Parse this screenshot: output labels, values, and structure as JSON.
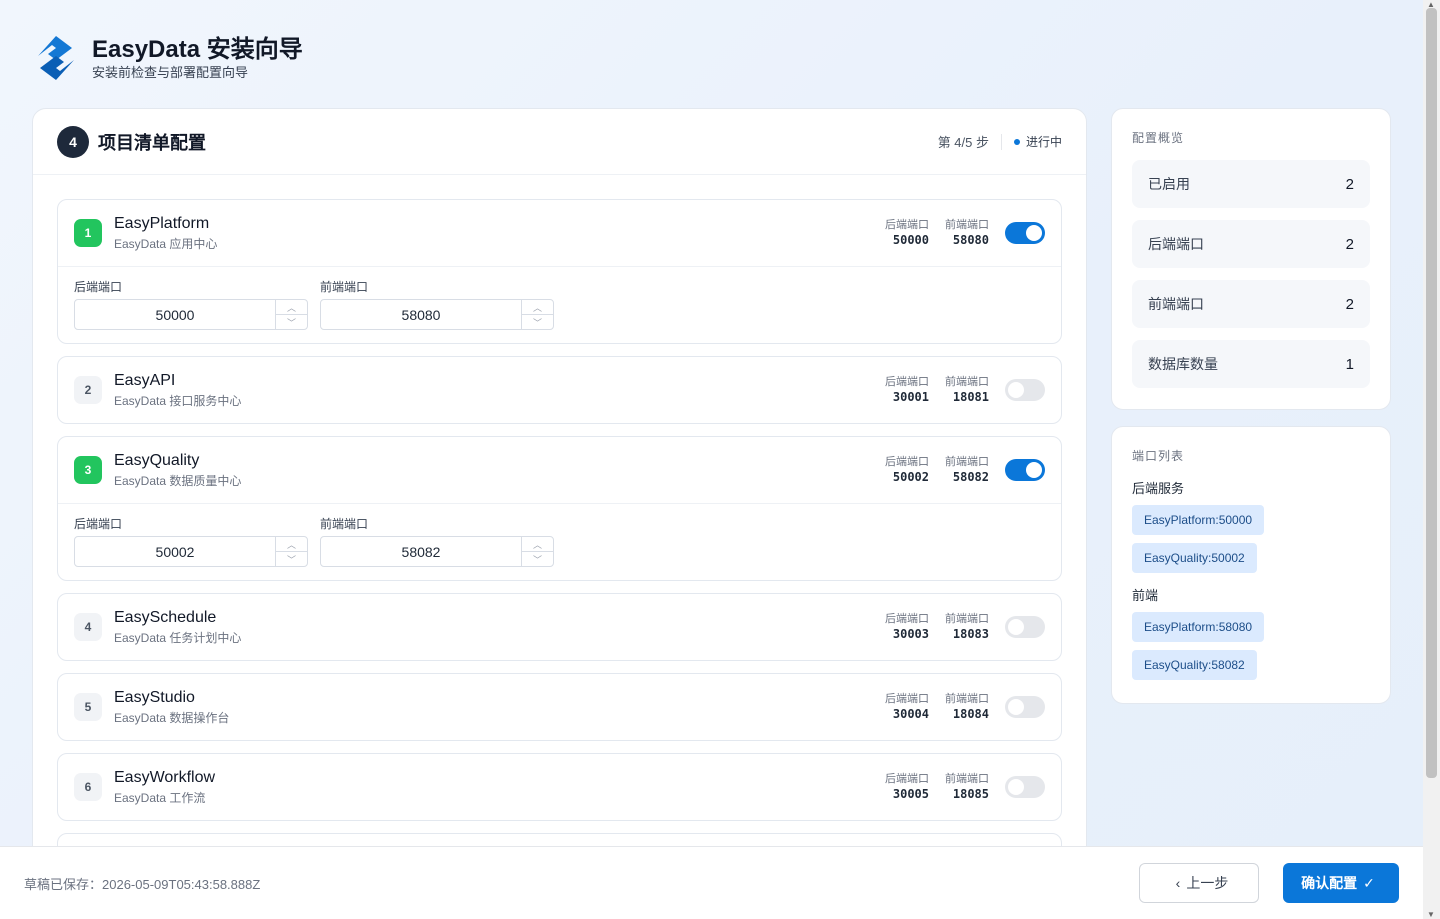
{
  "header": {
    "title": "EasyData 安装向导",
    "subtitle": "安装前检查与部署配置向导"
  },
  "step": {
    "number": "4",
    "title": "项目清单配置",
    "progress": "第 4/5 步",
    "status": "进行中"
  },
  "labels": {
    "backend_port": "后端端口",
    "frontend_port": "前端端口"
  },
  "projects": [
    {
      "num": "1",
      "name": "EasyPlatform",
      "desc": "EasyData 应用中心",
      "backend": "50000",
      "frontend": "58080",
      "enabled": true
    },
    {
      "num": "2",
      "name": "EasyAPI",
      "desc": "EasyData 接口服务中心",
      "backend": "30001",
      "frontend": "18081",
      "enabled": false
    },
    {
      "num": "3",
      "name": "EasyQuality",
      "desc": "EasyData 数据质量中心",
      "backend": "50002",
      "frontend": "58082",
      "enabled": true
    },
    {
      "num": "4",
      "name": "EasySchedule",
      "desc": "EasyData 任务计划中心",
      "backend": "30003",
      "frontend": "18083",
      "enabled": false
    },
    {
      "num": "5",
      "name": "EasyStudio",
      "desc": "EasyData 数据操作台",
      "backend": "30004",
      "frontend": "18084",
      "enabled": false
    },
    {
      "num": "6",
      "name": "EasyWorkflow",
      "desc": "EasyData 工作流",
      "backend": "30005",
      "frontend": "18085",
      "enabled": false
    }
  ],
  "overview": {
    "title": "配置概览",
    "stats": [
      {
        "label": "已启用",
        "value": "2"
      },
      {
        "label": "后端端口",
        "value": "2"
      },
      {
        "label": "前端端口",
        "value": "2"
      },
      {
        "label": "数据库数量",
        "value": "1"
      }
    ]
  },
  "port_list": {
    "title": "端口列表",
    "backend_label": "后端服务",
    "backend_tags": [
      "EasyPlatform:50000",
      "EasyQuality:50002"
    ],
    "frontend_label": "前端",
    "frontend_tags": [
      "EasyPlatform:58080",
      "EasyQuality:58082"
    ]
  },
  "footer": {
    "draft": "草稿已保存：2026-05-09T05:43:58.888Z",
    "prev": "上一步",
    "confirm": "确认配置"
  },
  "colors": {
    "accent": "#0b77d9",
    "success": "#22c55e",
    "tag_bg": "#dbeafe"
  }
}
